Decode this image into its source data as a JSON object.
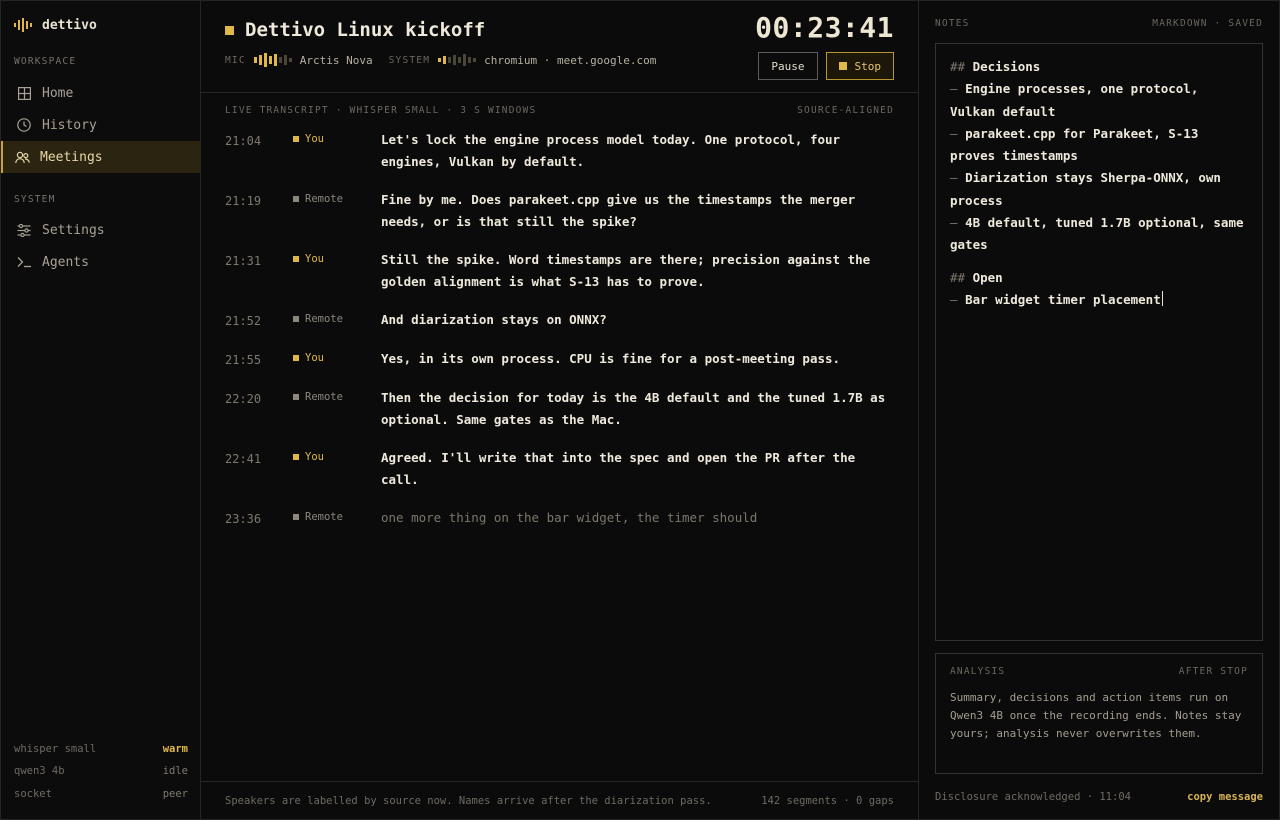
{
  "app": {
    "name": "dettivo"
  },
  "sidebar": {
    "workspace_label": "WORKSPACE",
    "workspace_items": [
      {
        "label": "Home",
        "icon": "grid-icon"
      },
      {
        "label": "History",
        "icon": "clock-icon"
      },
      {
        "label": "Meetings",
        "icon": "users-icon",
        "active": true
      }
    ],
    "system_label": "SYSTEM",
    "system_items": [
      {
        "label": "Settings",
        "icon": "sliders-icon"
      },
      {
        "label": "Agents",
        "icon": "terminal-icon"
      }
    ],
    "status": [
      {
        "name": "whisper small",
        "value": "warm"
      },
      {
        "name": "qwen3 4b",
        "value": "idle"
      },
      {
        "name": "socket",
        "value": "peer"
      }
    ]
  },
  "meeting": {
    "title": "Dettivo Linux kickoff",
    "timer": "00:23:41",
    "mic_label": "MIC",
    "mic_device": "Arctis Nova",
    "system_label": "SYSTEM",
    "system_source": "chromium · meet.google.com",
    "pause_label": "Pause",
    "stop_label": "Stop"
  },
  "transcript": {
    "header_left": "LIVE TRANSCRIPT · WHISPER SMALL · 3 S WINDOWS",
    "header_right": "SOURCE-ALIGNED",
    "segments": [
      {
        "time": "21:04",
        "speaker": "You",
        "text": "Let's lock the engine process model today. One protocol, four engines, Vulkan by default."
      },
      {
        "time": "21:19",
        "speaker": "Remote",
        "text": "Fine by me. Does parakeet.cpp give us the timestamps the merger needs, or is that still the spike?"
      },
      {
        "time": "21:31",
        "speaker": "You",
        "text": "Still the spike. Word timestamps are there; precision against the golden alignment is what S-13 has to prove."
      },
      {
        "time": "21:52",
        "speaker": "Remote",
        "text": "And diarization stays on ONNX?"
      },
      {
        "time": "21:55",
        "speaker": "You",
        "text": "Yes, in its own process. CPU is fine for a post-meeting pass."
      },
      {
        "time": "22:20",
        "speaker": "Remote",
        "text": "Then the decision for today is the 4B default and the tuned 1.7B as optional. Same gates as the Mac."
      },
      {
        "time": "22:41",
        "speaker": "You",
        "text": "Agreed. I'll write that into the spec and open the PR after the call."
      },
      {
        "time": "23:36",
        "speaker": "Remote",
        "text": "one more thing on the bar widget, the timer should",
        "partial": true
      }
    ],
    "footer_note": "Speakers are labelled by source now. Names arrive after the diarization pass.",
    "footer_stats": "142 segments · 0 gaps"
  },
  "notes": {
    "label": "NOTES",
    "status": "MARKDOWN · SAVED",
    "heading_marker": "##",
    "bullet_marker": "–",
    "decisions_heading": "Decisions",
    "decisions": [
      "Engine processes, one protocol, Vulkan default",
      "parakeet.cpp for Parakeet, S-13 proves timestamps",
      "Diarization stays Sherpa-ONNX, own process",
      "4B default, tuned 1.7B optional, same gates"
    ],
    "open_heading": "Open",
    "open_items": [
      "Bar widget timer placement"
    ],
    "analysis_label": "ANALYSIS",
    "analysis_when": "AFTER STOP",
    "analysis_text": "Summary, decisions and action items run on Qwen3 4B once the recording ends. Notes stay yours; analysis never overwrites them.",
    "disclosure": "Disclosure acknowledged · 11:04",
    "copy_label": "copy message"
  },
  "colors": {
    "accent": "#e0b84a",
    "remote": "#8c877d",
    "background": "#0b0b0b"
  }
}
